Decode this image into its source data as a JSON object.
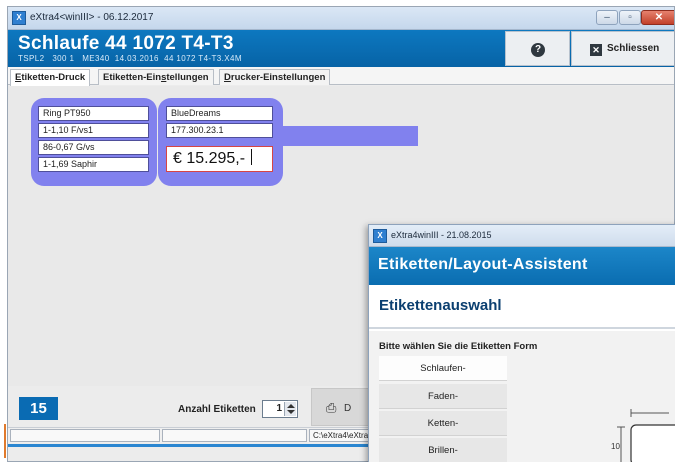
{
  "main_window": {
    "title": "eXtra4<winIII> - 06.12.2017",
    "header_title": "Schlaufe 44 1072 T4-T3",
    "header_sub": "TSPL2   300 1   ME340  14.03.2016  44 1072 T4-T3.X4M",
    "help_button_icon": "help-icon",
    "close_button_label": "Schliessen",
    "tabs": [
      {
        "pre": "E",
        "rest": "tiketten-Druck"
      },
      {
        "pre": "Etiketten-Ein",
        "u": "s",
        "rest": "tellungen"
      },
      {
        "pre": "",
        "u": "D",
        "rest": "rucker-Einstellungen"
      }
    ],
    "label_left": [
      "Ring PT950",
      "1-1,10 F/vs1",
      "86-0,67 G/vs",
      "1-1,69 Saphir"
    ],
    "label_right": [
      "BlueDreams",
      "177.300.23.1"
    ],
    "price": "€  15.295,-",
    "count_badge": "15",
    "anzahl_label": "Anzahl Etiketten",
    "anzahl_value": "1",
    "print_button_label": "D",
    "status_path": "C:\\eXtra4\\eXtra",
    "colors": {
      "header_blue": "#0b6db5",
      "label_blob": "#8181ee",
      "price_border": "#d64545"
    }
  },
  "assistant_window": {
    "title": "eXtra4winIII  -  21.08.2015",
    "header_title": "Etiketten/Layout-Assistent",
    "section_title": "Etikettenauswahl",
    "prompt": "Bitte wählen Sie die Etiketten Form",
    "forms": [
      "Schlaufen-",
      "Faden-",
      "Ketten-",
      "Brillen-"
    ],
    "selected_form": "Schlaufen-",
    "preview_dimension": "10"
  }
}
